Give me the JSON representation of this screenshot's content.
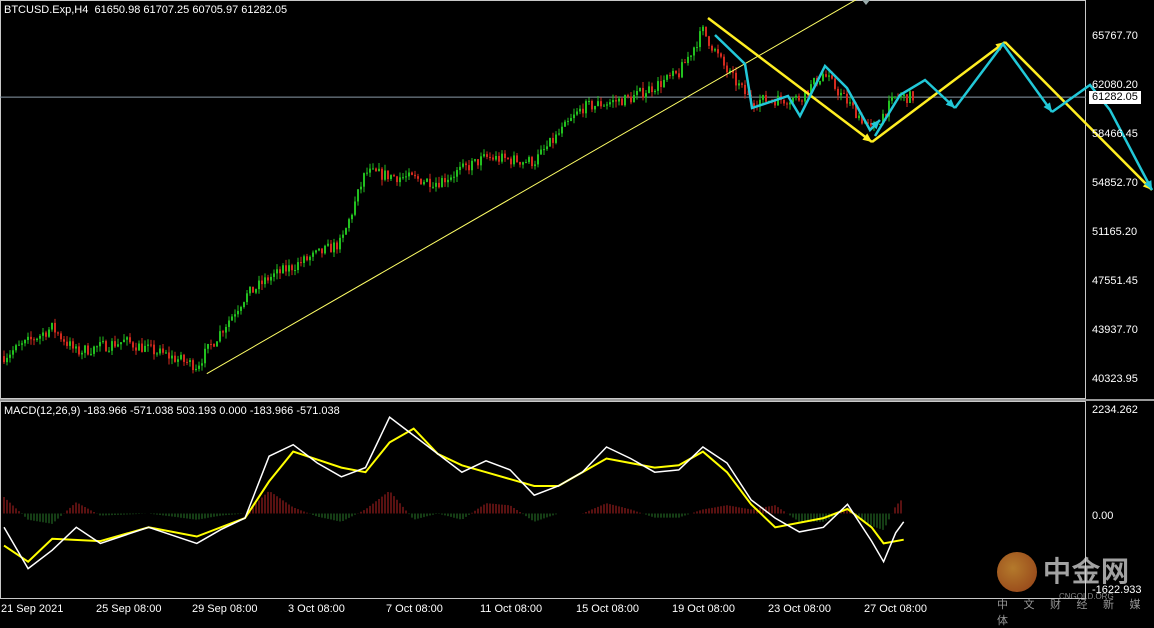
{
  "header": {
    "symbol_info": "BTCUSD.Exp,H4  61650.98 61707.25 60705.97 61282.05",
    "macd_info": "MACD(12,26,9) -183.966 -571.038 503.193 0.000 -183.966 -571.038"
  },
  "price_axis": {
    "ticks": [
      "65767.70",
      "62080.20",
      "58466.45",
      "54852.70",
      "51165.20",
      "47551.45",
      "43937.70",
      "40323.95"
    ],
    "current_price": "61282.05"
  },
  "macd_axis": {
    "ticks": [
      "2234.262",
      "0.00",
      "-1622.933"
    ]
  },
  "time_axis": {
    "ticks": [
      "21 Sep 2021",
      "25 Sep 08:00",
      "29 Sep 08:00",
      "3 Oct 08:00",
      "7 Oct 08:00",
      "11 Oct 08:00",
      "15 Oct 08:00",
      "19 Oct 08:00",
      "23 Oct 08:00",
      "27 Oct 08:00"
    ]
  },
  "watermark": {
    "brand": "中金网",
    "domain": "CNGOLD.ORG",
    "tagline": "中 文 财 经 新 媒 体"
  },
  "colors": {
    "background": "#000000",
    "bull_candle": "#22c11f",
    "bear_candle": "#d42a1e",
    "trendline": "#ffff66",
    "projection_yellow": "#ffee22",
    "projection_cyan": "#22c8d8",
    "macd_line": "#ffffff",
    "signal_line": "#ffff00",
    "hist_positive": "#b22222",
    "hist_negative": "#2a7a2a"
  },
  "chart_data": [
    {
      "type": "candlestick",
      "title": "BTCUSD.Exp,H4",
      "timeframe": "H4",
      "last_bar": {
        "open": 61650.98,
        "high": 61707.25,
        "low": 60705.97,
        "close": 61282.05
      },
      "ylim": [
        39500,
        68500
      ],
      "x_range": [
        "2021-09-21",
        "2021-10-28"
      ],
      "approx_close_path": [
        {
          "t": "2021-09-21",
          "close": 42100
        },
        {
          "t": "2021-09-23",
          "close": 44200
        },
        {
          "t": "2021-09-24",
          "close": 42400
        },
        {
          "t": "2021-09-26",
          "close": 43200
        },
        {
          "t": "2021-09-29",
          "close": 41400
        },
        {
          "t": "2021-10-01",
          "close": 46500
        },
        {
          "t": "2021-10-02",
          "close": 47900
        },
        {
          "t": "2021-10-05",
          "close": 50500
        },
        {
          "t": "2021-10-06",
          "close": 55700
        },
        {
          "t": "2021-10-09",
          "close": 55000
        },
        {
          "t": "2021-10-11",
          "close": 56800
        },
        {
          "t": "2021-10-13",
          "close": 56500
        },
        {
          "t": "2021-10-15",
          "close": 60500
        },
        {
          "t": "2021-10-17",
          "close": 61200
        },
        {
          "t": "2021-10-19",
          "close": 63000
        },
        {
          "t": "2021-10-20",
          "close": 66200
        },
        {
          "t": "2021-10-21",
          "close": 63200
        },
        {
          "t": "2021-10-22",
          "close": 61000
        },
        {
          "t": "2021-10-24",
          "close": 61200
        },
        {
          "t": "2021-10-25",
          "close": 63000
        },
        {
          "t": "2021-10-27",
          "close": 58800
        },
        {
          "t": "2021-10-28",
          "close": 61282
        }
      ]
    },
    {
      "type": "line",
      "title": "MACD(12,26,9)",
      "values": {
        "macd": -183.966,
        "signal": -571.038
      },
      "ylim": [
        -1622.933,
        2234.262
      ]
    }
  ]
}
